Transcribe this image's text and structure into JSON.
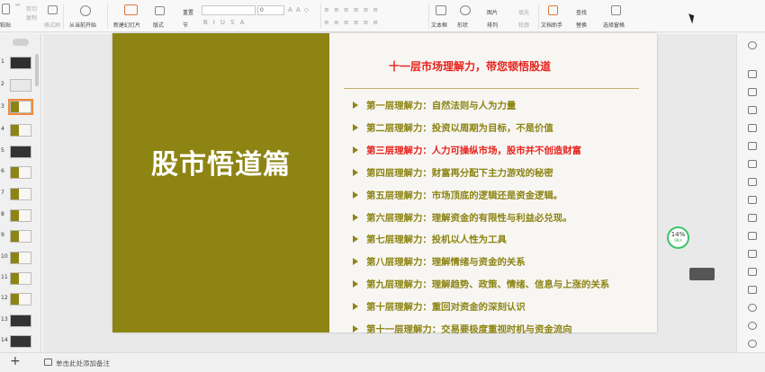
{
  "ribbon": {
    "paste_label": "粘贴",
    "cut_label": "剪切",
    "copy_label": "复制",
    "format_painter_label": "格式刷",
    "from_current_label": "从当前开始",
    "new_slide_label": "新建幻灯片",
    "layout_label": "版式",
    "section_label": "节",
    "reset_label": "重置",
    "font_size_value": "0",
    "textbox_label": "文本框",
    "shape_label": "形状",
    "arrange_label": "排列",
    "picture_label": "图片",
    "fill_label": "填充",
    "outline_label": "轮廓",
    "doc_helper_label": "文档助手",
    "find_label": "查找",
    "replace_label": "替换",
    "select_pane_label": "选择窗格"
  },
  "thumbnails": [
    "1",
    "2",
    "3",
    "4",
    "5",
    "6",
    "7",
    "8",
    "9",
    "10",
    "11",
    "12",
    "13",
    "14"
  ],
  "selected_slide": "3",
  "slide": {
    "left_title": "股市悟道篇",
    "headline": "十一层市场理解力，带您顿悟股道",
    "items": [
      "第一层理解力：自然法则与人为力量",
      "第二层理解力：投资以周期为目标，不是价值",
      "第三层理解力：人力可操纵市场，股市并不创造财富",
      "第四层理解力：财富再分配下主力游戏的秘密",
      "第五层理解力：市场顶底的逻辑还是资金逻辑。",
      "第六层理解力：理解资金的有限性与利益必兑现。",
      "第七层理解力：投机以人性为工具",
      "第八层理解力：理解情绪与资金的关系",
      "第九层理解力：理解趋势、政策、情绪、信息与上涨的关系",
      "第十层理解力：重回对资金的深刻认识",
      "第十一层理解力：交易要极度重视时机与资金流向"
    ],
    "highlight_index": 2
  },
  "progress": {
    "percent": "14%",
    "speed": "0K/s"
  },
  "status": {
    "add_slide": "+",
    "note_placeholder": "单击此处添加备注"
  },
  "colors": {
    "olive": "#8d8414",
    "red": "#e8231d",
    "progress_green": "#3cc46a"
  }
}
